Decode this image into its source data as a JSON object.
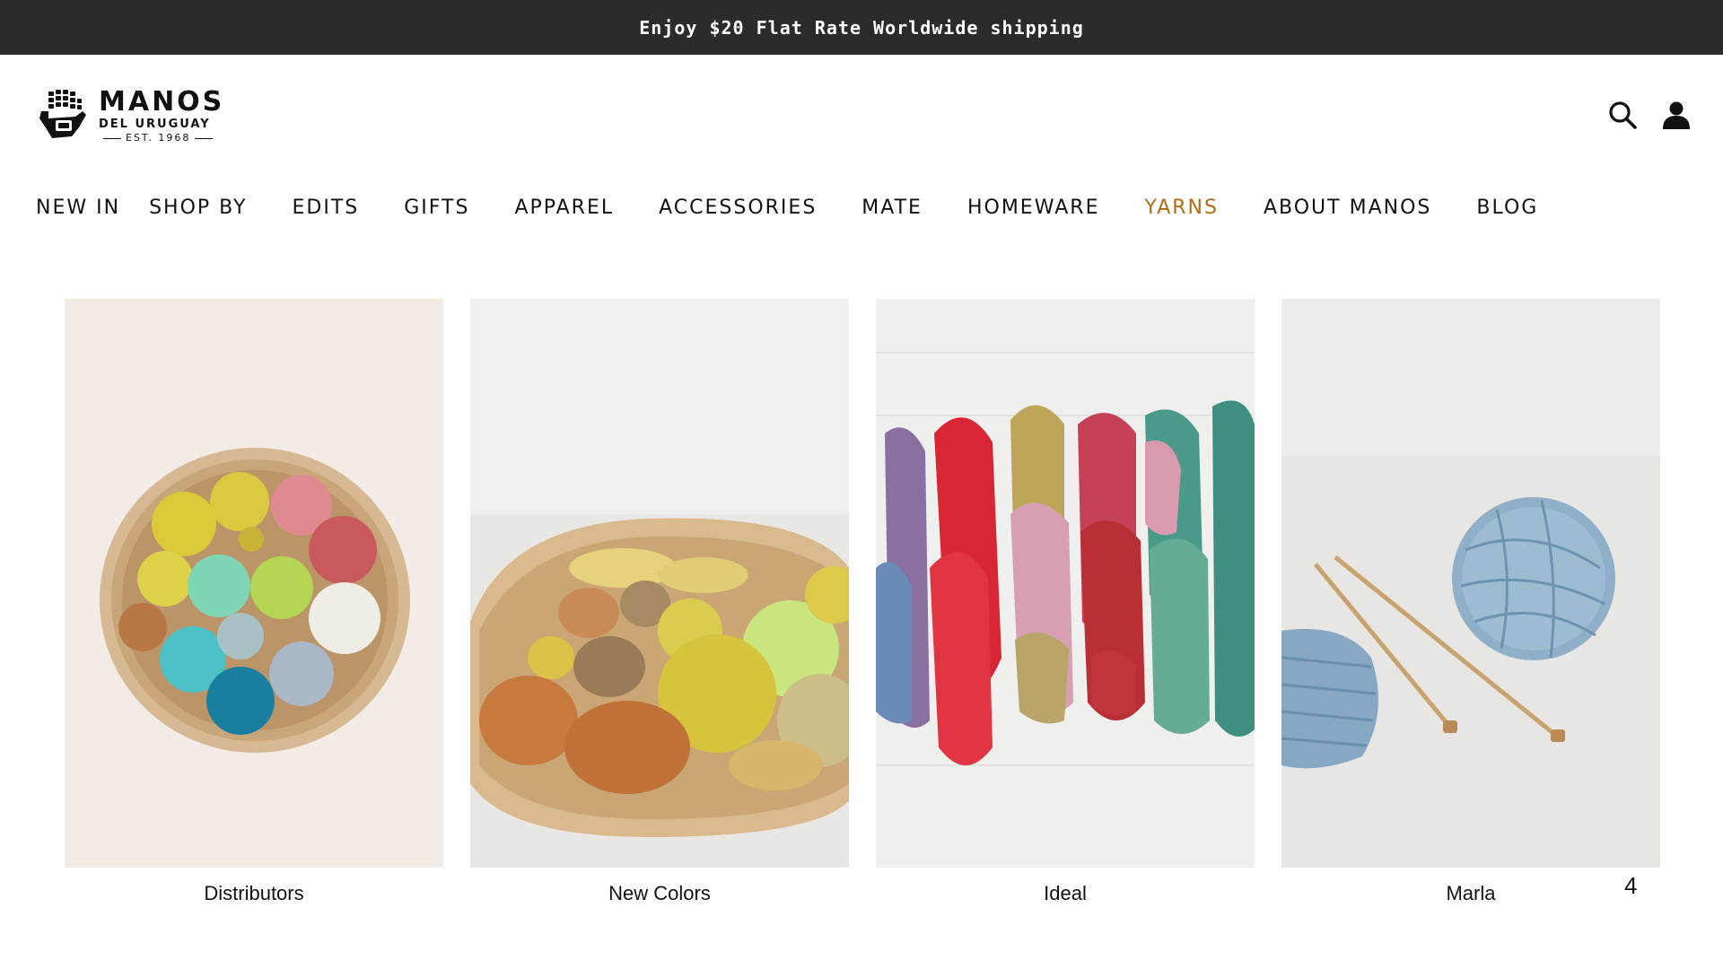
{
  "announcement": {
    "text": "Enjoy $20 Flat Rate Worldwide shipping"
  },
  "logo": {
    "name": "MANOS",
    "subtitle": "DEL URUGUAY",
    "established": "EST. 1968"
  },
  "header_icons": [
    {
      "icon": "search-icon"
    },
    {
      "icon": "account-icon"
    }
  ],
  "nav": {
    "items": [
      {
        "label": "NEW IN"
      },
      {
        "label": "SHOP BY"
      },
      {
        "label": "EDITS"
      },
      {
        "label": "GIFTS"
      },
      {
        "label": "APPAREL"
      },
      {
        "label": "ACCESSORIES"
      },
      {
        "label": "MATE"
      },
      {
        "label": "HOMEWARE"
      },
      {
        "label": "YARNS"
      },
      {
        "label": "ABOUT MANOS"
      },
      {
        "label": "BLOG"
      }
    ],
    "active_index": 8,
    "active_color": "#b06a12"
  },
  "cards": [
    {
      "label": "Distributors",
      "image": "basket of yarn balls viewed from above"
    },
    {
      "label": "New Colors",
      "image": "basket of yarn balls and skeins"
    },
    {
      "label": "Ideal",
      "image": "row of hand-dyed yarn skeins"
    },
    {
      "label": "Marla",
      "image": "blue yarn ball with knitting needles and swatch"
    }
  ],
  "page_indicator": "4",
  "colors": {
    "announcement_bg": "#2b2b2b",
    "accent": "#b06a12"
  }
}
